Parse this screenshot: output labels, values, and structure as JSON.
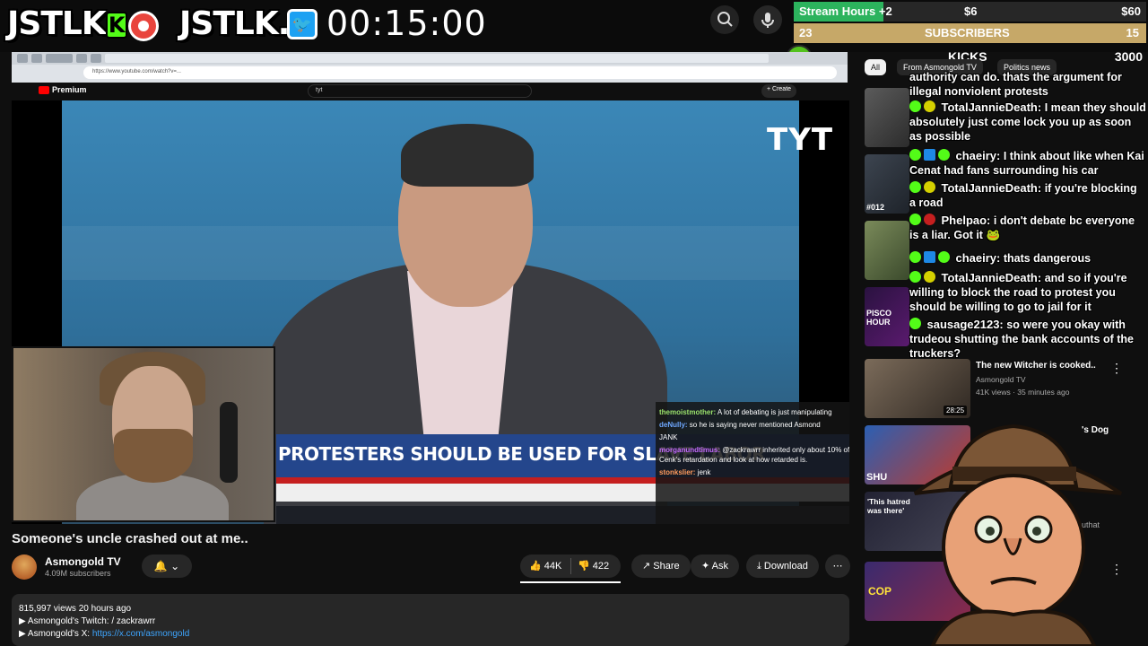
{
  "overlay": {
    "logo_left": "JSTLK",
    "logo_k": "K",
    "logo_right": "JSTLK.",
    "twitter_glyph": "🐦",
    "timer": "00:15:00",
    "goals": {
      "stream_hours_label": "Stream Hours +2",
      "stream_hours_mid": "$6",
      "stream_hours_max": "$60",
      "subs_current": "23",
      "subs_label": "SUBSCRIBERS",
      "subs_target": "15",
      "kicks_label": "KICKS",
      "kicks_value": "3000",
      "kicks_badge": "3",
      "accent_green": "#2cb35d",
      "accent_gold": "#c6a868"
    }
  },
  "browser": {
    "address": "https://www.youtube.com/watch?v=..."
  },
  "youtube": {
    "brand": "Premium",
    "search_value": "tyt",
    "create_label": "+ Create",
    "video": {
      "watermark": "TYT",
      "chyron": "PROTESTERS SHOULD BE USED FOR SLAVE LABOR",
      "overlay_chat": [
        {
          "user": "themoistmother:",
          "text": "A lot of debating is just manipulating"
        },
        {
          "user": "deNully:",
          "text": "so he is saying never mentioned Asmond"
        },
        {
          "user": "",
          "text": "JANK"
        },
        {
          "user": "morganundtimus:",
          "text": "@zackrawrr inherited only about 10% of Cenk's retardation and look at how retarded is."
        },
        {
          "user": "stonkslier:",
          "text": "jenk"
        }
      ]
    },
    "title": "Someone's uncle crashed out at me..",
    "channel": {
      "name": "Asmongold TV",
      "subscribers": "4.09M subscribers"
    },
    "actions": {
      "likes": "44K",
      "dislikes": "422",
      "share": "Share",
      "ask": "Ask",
      "download": "Download",
      "more": "⋯"
    },
    "description": {
      "meta": "815,997 views  20 hours ago",
      "line1_prefix": "▶ Asmongold's Twitch: ",
      "line1_value": "/ zackrawrr",
      "line2_prefix": "▶ Asmongold's X: ",
      "line2_link": "https://x.com/asmongold"
    }
  },
  "sidebar": {
    "tabs": [
      "All",
      "From Asmongold TV",
      "Politics news"
    ],
    "recommended": [
      {
        "title": "The new Witcher is cooked..",
        "channel": "Asmongold TV",
        "meta": "41K views · 35 minutes ago",
        "duration": "28:25"
      },
      {
        "title": "'s Dog"
      },
      {
        "channel": "uthat"
      }
    ]
  },
  "chat": [
    {
      "name": "",
      "text": "authority can do. thats the argument for illegal nonviolent protests",
      "badges": []
    },
    {
      "name": "TotalJannieDeath:",
      "text": "I mean they should absolutely just come lock you up as soon as possible",
      "badges": [
        "green",
        "yellow"
      ]
    },
    {
      "name": "chaeiry:",
      "text": "I think about like when Kai Cenat had fans surrounding his car",
      "badges": [
        "green",
        "blue",
        "green"
      ]
    },
    {
      "name": "TotalJannieDeath:",
      "text": "if you're blocking a road",
      "badges": [
        "green",
        "yellow"
      ]
    },
    {
      "name": "Phelpao:",
      "text": "i don't debate bc everyone is a liar. Got it 🐸",
      "badges": [
        "green",
        "red"
      ]
    },
    {
      "name": "chaeiry:",
      "text": "thats dangerous",
      "badges": [
        "green",
        "blue",
        "green"
      ]
    },
    {
      "name": "TotalJannieDeath:",
      "text": "and so if you're willing to block the road to protest you should be willing to go to jail for it",
      "badges": [
        "green",
        "yellow"
      ]
    },
    {
      "name": "sausage2123:",
      "text": "so were you okay with trudeou shutting the bank accounts of the truckers?",
      "badges": [
        "green"
      ]
    }
  ],
  "thumb_labels": {
    "podcast": "PISCO HOUR",
    "episode": "#012",
    "hatred": "'This hatred was there'",
    "cop": "COP",
    "sh": "SHU"
  },
  "webcam_alt": "webcam"
}
